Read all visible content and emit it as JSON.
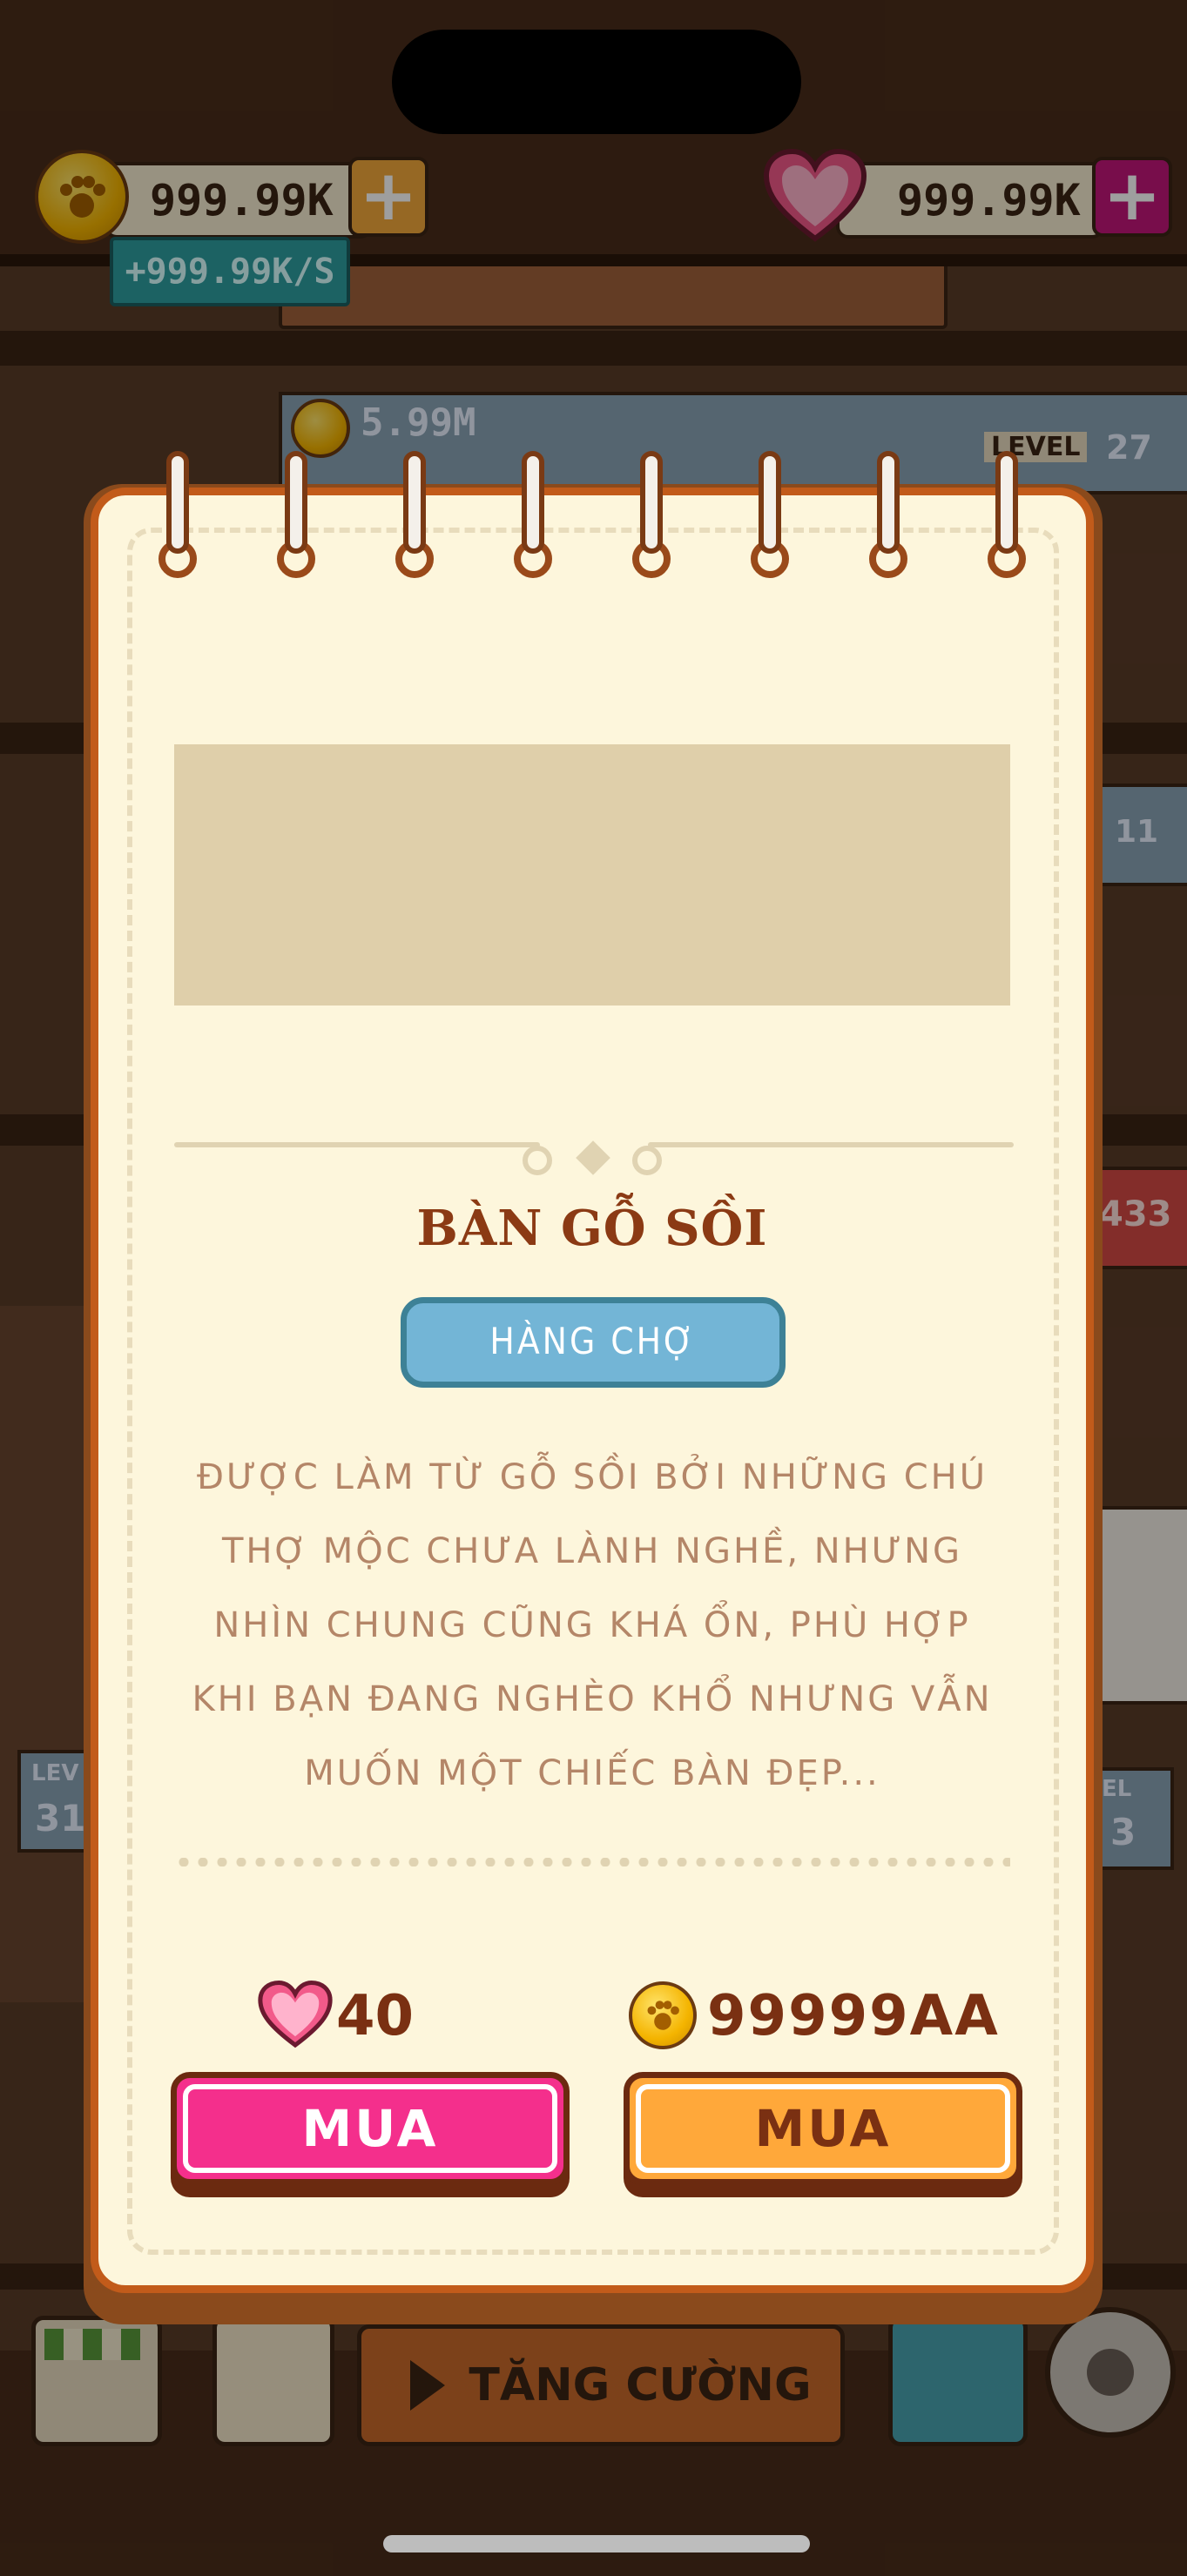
{
  "top_bar": {
    "coins": "999.99K",
    "gems": "999.99K",
    "coin_rate": "+999.99K/S"
  },
  "background": {
    "floor_coins": "5.99M",
    "level_label": "LEVEL",
    "level_value": "27",
    "side_number_1": "11",
    "side_number_2": "433",
    "left_level_label": "LEV",
    "left_level_value": "31",
    "right_level_label": "EL",
    "right_level_value": "3"
  },
  "bottom_nav": {
    "boost_label": "TĂNG CƯỜNG"
  },
  "modal": {
    "title": "BÀN GỖ SỒI",
    "tag": "HÀNG CHỢ",
    "description": "ĐƯỢC LÀM TỪ GỖ SỒI BỞI NHỮNG CHÚ THỢ MỘC CHƯA LÀNH NGHỀ, NHƯNG NHÌN CHUNG CŨNG KHÁ ỔN, PHÙ HỢP KHI BẠN ĐANG NGHÈO KHỔ NHƯNG VẪN MUỐN MỘT CHIẾC BÀN ĐẸP...",
    "gem_price": "40",
    "coin_price": "99999AA",
    "buy_gem_label": "MUA",
    "buy_coin_label": "MUA"
  },
  "colors": {
    "modal_border": "#c25b1a",
    "modal_bg": "#fdf6dc",
    "title": "#8b3a14",
    "tag_bg": "#73b5d6",
    "buy_gem": "#f42f8c",
    "buy_coin": "#ffa83a",
    "gem_plus": "#c2167a",
    "coin_plus": "#f2a93b"
  }
}
